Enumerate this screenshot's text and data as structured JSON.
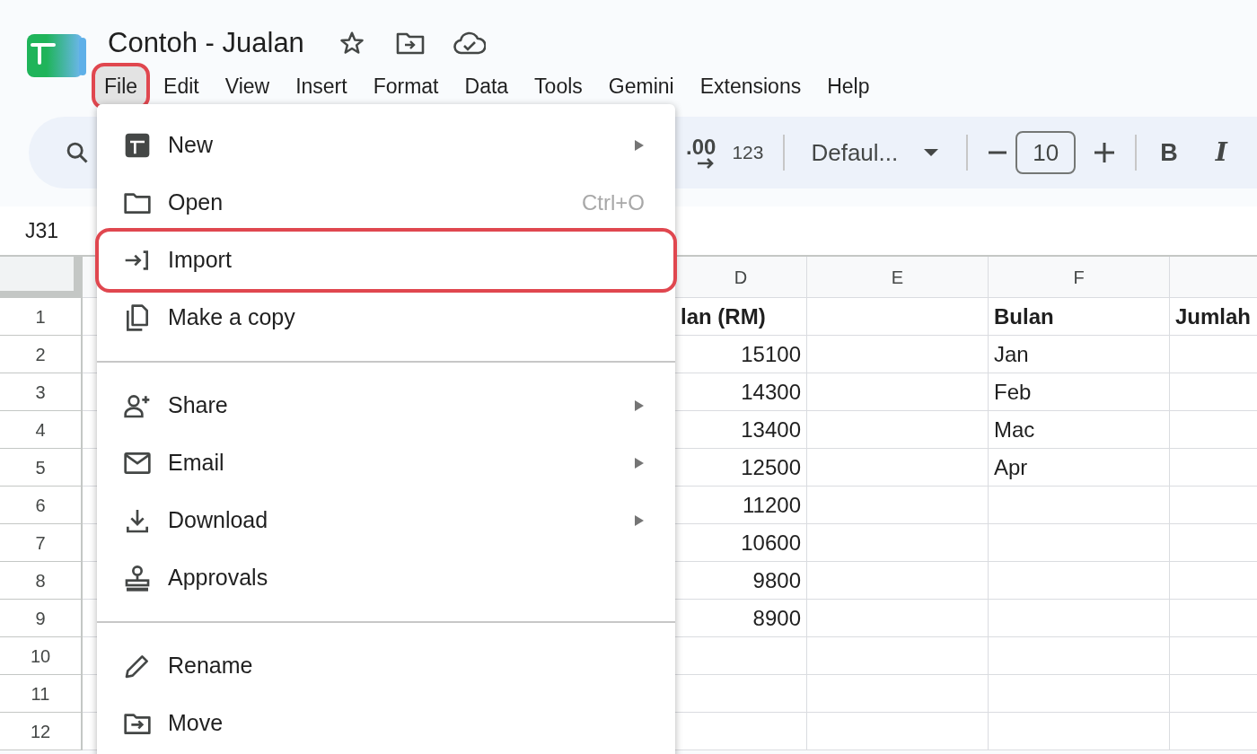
{
  "document": {
    "title": "Contoh - Jualan"
  },
  "menubar": [
    {
      "label": "File",
      "selected": true,
      "outlined": true
    },
    {
      "label": "Edit",
      "selected": false,
      "outlined": false
    },
    {
      "label": "View",
      "selected": false,
      "outlined": false
    },
    {
      "label": "Insert",
      "selected": false,
      "outlined": false
    },
    {
      "label": "Format",
      "selected": false,
      "outlined": false
    },
    {
      "label": "Data",
      "selected": false,
      "outlined": false
    },
    {
      "label": "Tools",
      "selected": false,
      "outlined": false
    },
    {
      "label": "Gemini",
      "selected": false,
      "outlined": false
    },
    {
      "label": "Extensions",
      "selected": false,
      "outlined": false
    },
    {
      "label": "Help",
      "selected": false,
      "outlined": false
    }
  ],
  "toolbar": {
    "decimal": ".00",
    "number_format": "123",
    "font": "Defaul...",
    "font_size": "10",
    "bold": "B",
    "italic": "I"
  },
  "name_box": "J31",
  "grid": {
    "columns": [
      "D",
      "E",
      "F"
    ],
    "rows": [
      {
        "number": "1",
        "bold": true,
        "col_d": "lan (RM)",
        "col_f": "Bulan",
        "col_g": "Jumlah"
      },
      {
        "number": "2",
        "bold": false,
        "col_d": "15100",
        "col_f": "Jan"
      },
      {
        "number": "3",
        "bold": false,
        "col_d": "14300",
        "col_f": "Feb"
      },
      {
        "number": "4",
        "bold": false,
        "col_d": "13400",
        "col_f": "Mac"
      },
      {
        "number": "5",
        "bold": false,
        "col_d": "12500",
        "col_f": "Apr"
      },
      {
        "number": "6",
        "bold": false,
        "col_d": "11200"
      },
      {
        "number": "7",
        "bold": false,
        "col_d": "10600"
      },
      {
        "number": "8",
        "bold": false,
        "col_d": "9800"
      },
      {
        "number": "9",
        "bold": false,
        "col_d": "8900"
      },
      {
        "number": "10"
      },
      {
        "number": "11"
      },
      {
        "number": "12"
      }
    ]
  },
  "file_menu": [
    {
      "kind": "item",
      "label": "New",
      "submenu": true,
      "outlined": false
    },
    {
      "kind": "item",
      "label": "Open",
      "shortcut": "Ctrl+O",
      "submenu": false,
      "outlined": false
    },
    {
      "kind": "item",
      "label": "Import",
      "submenu": false,
      "outlined": true
    },
    {
      "kind": "item",
      "label": "Make a copy",
      "submenu": false,
      "outlined": false
    },
    {
      "kind": "divider"
    },
    {
      "kind": "item",
      "label": "Share",
      "submenu": true,
      "outlined": false
    },
    {
      "kind": "item",
      "label": "Email",
      "submenu": true,
      "outlined": false
    },
    {
      "kind": "item",
      "label": "Download",
      "submenu": true,
      "outlined": false
    },
    {
      "kind": "item",
      "label": "Approvals",
      "submenu": false,
      "outlined": false
    },
    {
      "kind": "divider"
    },
    {
      "kind": "item",
      "label": "Rename",
      "submenu": false,
      "outlined": false
    },
    {
      "kind": "item",
      "label": "Move",
      "submenu": false,
      "outlined": false
    }
  ]
}
